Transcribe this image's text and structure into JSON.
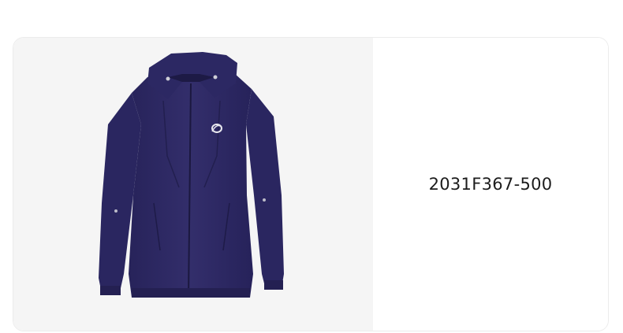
{
  "product": {
    "sku": "2031F367-500",
    "image_icon": "jacket-image",
    "color_hex": "#2e2a63",
    "logo_icon": "asics-logo-icon"
  },
  "colors": {
    "image_background": "#f5f5f5",
    "card_border": "#ececec",
    "text": "#1c1c1c"
  }
}
